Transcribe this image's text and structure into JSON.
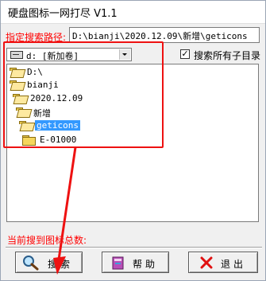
{
  "window": {
    "title": "硬盘图标一网打尽 V1.1"
  },
  "path": {
    "label": "指定搜索路径:",
    "value": "D:\\bianji\\2020.12.09\\新增\\geticons"
  },
  "drive_select": {
    "value": "d: [新加卷]"
  },
  "subfolders_checkbox": {
    "label": "搜索所有子目录",
    "checked": true
  },
  "tree": {
    "items": [
      {
        "label": "D:\\"
      },
      {
        "label": "bianji"
      },
      {
        "label": "2020.12.09"
      },
      {
        "label": "新增"
      },
      {
        "label": "geticons",
        "selected": true
      },
      {
        "label": "E-01000"
      }
    ]
  },
  "status": {
    "label": "当前搜到图标总数:"
  },
  "buttons": {
    "search": "搜索",
    "help": "帮助",
    "exit": "退出"
  },
  "colors": {
    "label_red": "#ff0000",
    "selection": "#3399ff",
    "annotation_red": "#e11111",
    "folder_yellow": "#f5d65c"
  }
}
